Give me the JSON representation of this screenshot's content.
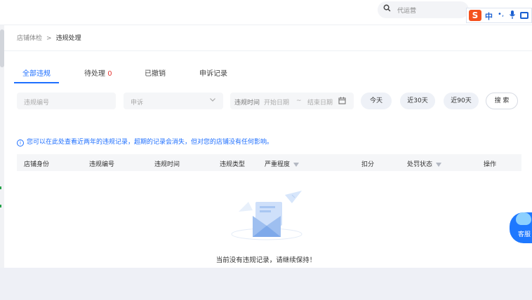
{
  "topbar": {
    "search_placeholder": "代运营",
    "ime": {
      "logo": "S",
      "lang": "中",
      "punct": "•,",
      "mic": "🎙"
    }
  },
  "breadcrumb": {
    "parent": "店铺体检",
    "separator": ">",
    "current": "违规处理"
  },
  "tabs": [
    {
      "label": "全部违规",
      "count": ""
    },
    {
      "label": "待处理",
      "count": "0"
    },
    {
      "label": "已撤销",
      "count": ""
    },
    {
      "label": "申诉记录",
      "count": ""
    }
  ],
  "filters": {
    "violation_no_placeholder": "违规编号",
    "appeal_select_value": "申诉",
    "date_label": "违规时间",
    "start_placeholder": "开始日期",
    "range_sep": "~",
    "end_placeholder": "结束日期",
    "today": "今天",
    "last30": "近30天",
    "last90": "近90天",
    "search": "搜 索"
  },
  "info_text": "您可以在此处查看近两年的违规记录，超期的记录会消失，但对您的店铺没有任何影响。",
  "table": {
    "columns": [
      "店铺身份",
      "违规编号",
      "违规时间",
      "违规类型",
      "严重程度",
      "扣分",
      "处罚状态",
      "操作"
    ]
  },
  "empty_text": "当前没有违规记录，请继续保持！",
  "kefu_label": "客服",
  "colors": {
    "accent": "#1e6fff",
    "count_red": "#e53935",
    "footer_bg": "#eef0f6"
  }
}
